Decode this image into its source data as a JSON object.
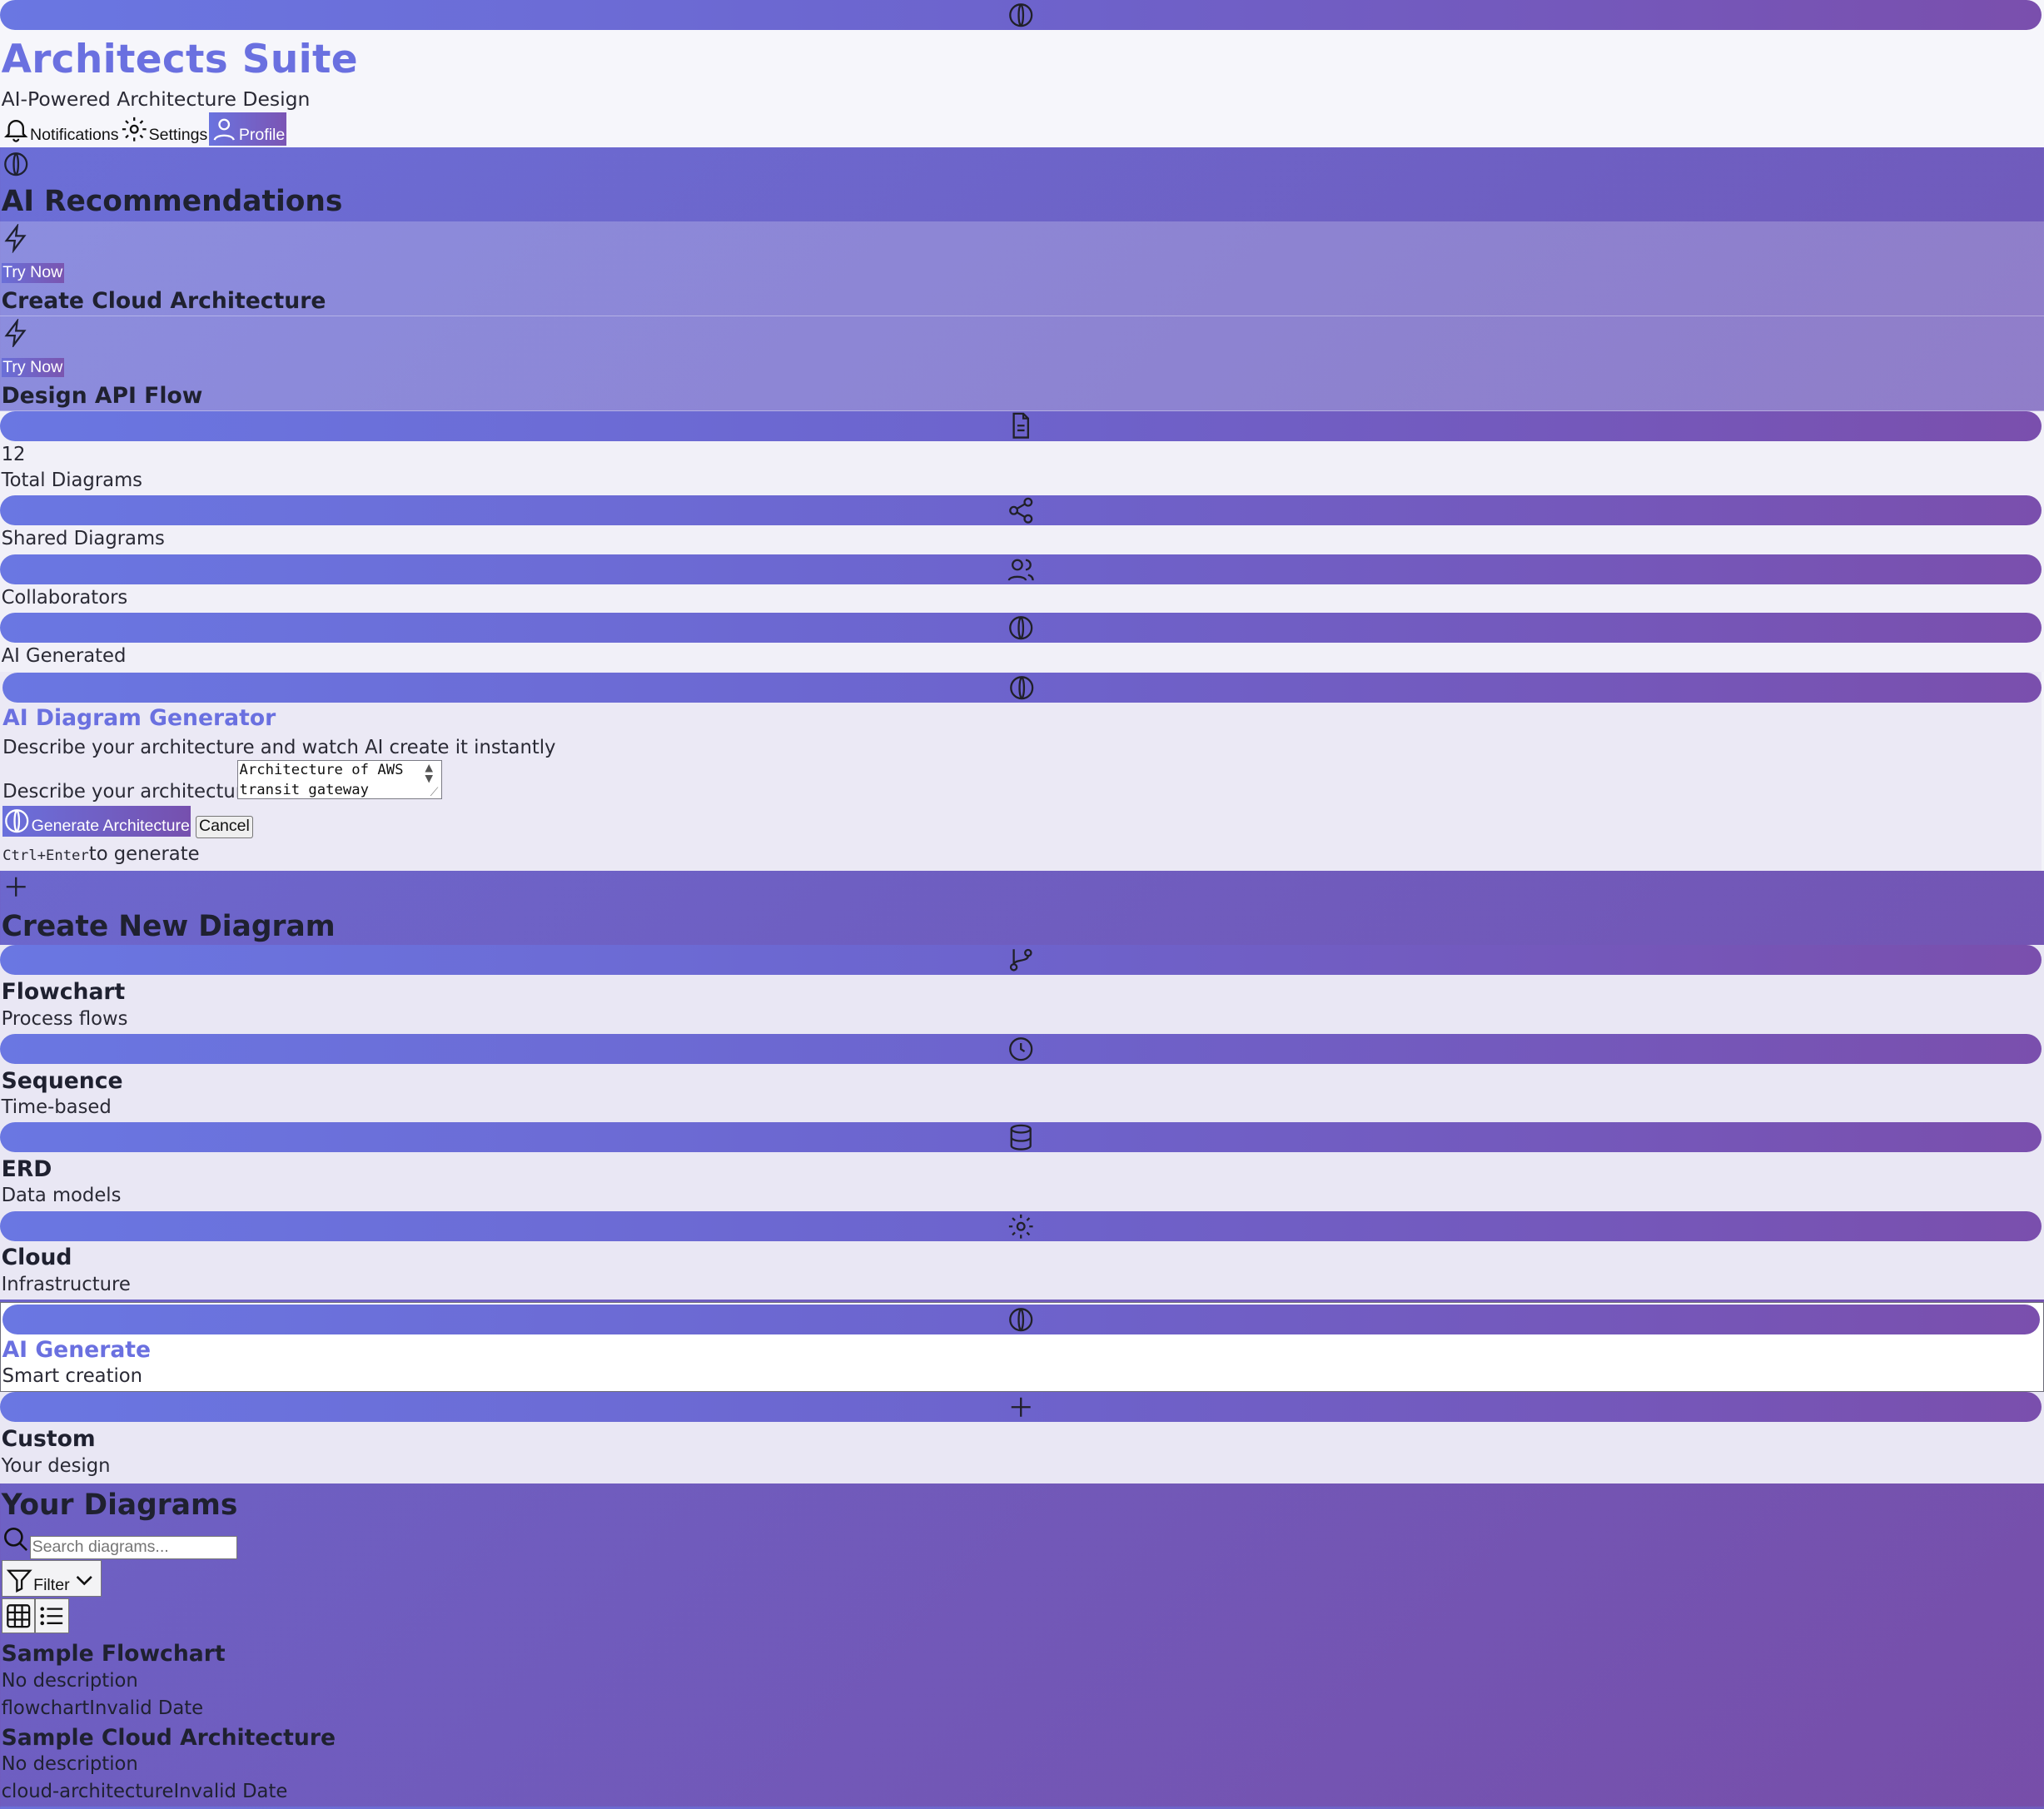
{
  "header": {
    "title": "Architects Suite",
    "subtitle": "AI-Powered Architecture Design",
    "icon": "brain-icon",
    "actions": [
      {
        "label": "Notifications",
        "icon": "bell-icon"
      },
      {
        "label": "Settings",
        "icon": "gear-icon"
      },
      {
        "label": "Profile",
        "icon": "user-icon",
        "active": true
      }
    ]
  },
  "ai_recommendations": {
    "heading": "AI Recommendations",
    "icon": "brain-icon",
    "cards": [
      {
        "icon": "bolt-icon",
        "action": "Try Now",
        "title": "Create Cloud Architecture"
      },
      {
        "icon": "bolt-icon",
        "action": "Try Now",
        "title": "Design API Flow"
      }
    ]
  },
  "stats": [
    {
      "icon": "document-icon",
      "value": "12",
      "label": "Total Diagrams"
    },
    {
      "icon": "share-icon",
      "value": "",
      "label": "Shared Diagrams"
    },
    {
      "icon": "users-icon",
      "value": "",
      "label": "Collaborators"
    },
    {
      "icon": "brain-icon",
      "value": "",
      "label": "AI Generated"
    }
  ],
  "generator": {
    "icon": "brain-icon",
    "title": "AI Diagram Generator",
    "description": "Describe your architecture and watch AI create it instantly",
    "input_label": "Describe your architecture:",
    "input_value": "Architecture of AWS transit gateway",
    "generate_label": "Generate Architecture",
    "cancel_label": "Cancel",
    "hint_keys": "Ctrl+Enter",
    "hint_text": "to generate"
  },
  "create": {
    "heading": "Create New Diagram",
    "icon": "plus-icon",
    "types": [
      {
        "icon": "git-branch-icon",
        "name": "Flowchart",
        "desc": "Process flows"
      },
      {
        "icon": "clock-icon",
        "name": "Sequence",
        "desc": "Time-based"
      },
      {
        "icon": "database-icon",
        "name": "ERD",
        "desc": "Data models"
      },
      {
        "icon": "gear-icon",
        "name": "Cloud",
        "desc": "Infrastructure"
      },
      {
        "icon": "brain-icon",
        "name": "AI Generate",
        "desc": "Smart creation"
      },
      {
        "icon": "plus-icon",
        "name": "Custom",
        "desc": "Your design"
      }
    ]
  },
  "diagrams": {
    "heading": "Your Diagrams",
    "search_placeholder": "Search diagrams...",
    "filter_label": "Filter",
    "items": [
      {
        "name": "Sample Flowchart",
        "description": "No description",
        "type": "flowchart",
        "date": "Invalid Date"
      },
      {
        "name": "Sample Cloud Architecture",
        "description": "No description",
        "type": "cloud-architecture",
        "date": "Invalid Date"
      }
    ]
  },
  "colors": {
    "accent": "#6a70e0",
    "gradient_start": "#6a77e2",
    "gradient_end": "#7a4fad"
  }
}
